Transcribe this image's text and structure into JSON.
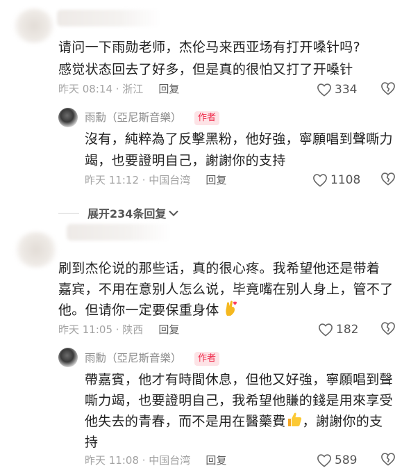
{
  "comment1": {
    "text_line1": "请问一下雨勋老师，杰伦马来西亚场有打开嗓针吗?",
    "text_line2": "感觉状态回去了好多，但是真的很怕又打了开嗓针",
    "meta": "昨天 08:14 · 浙江",
    "reply_label": "回复",
    "likes": "334"
  },
  "reply1": {
    "author": "雨勳（亞尼斯音樂）",
    "badge": "作者",
    "text_line1": "沒有，純粹為了反擊黑粉，他好強，寧願唱到聲嘶力",
    "text_line2": "竭，也要證明自己，謝謝你的支持",
    "meta": "昨天 11:12 · 中国台湾",
    "reply_label": "回复",
    "likes": "1108"
  },
  "expand": {
    "label": "展开234条回复"
  },
  "comment2": {
    "text_line1": "刷到杰伦说的那些话，真的很心疼。我希望他还是带着",
    "text_line2": "嘉宾，不用在意别人怎么说，毕竟嘴在别人身上，管不了",
    "text_line3": "他。但请你一定要保重身体",
    "meta": "昨天 11:05 · 陕西",
    "reply_label": "回复",
    "likes": "182"
  },
  "reply2": {
    "author": "雨勳（亞尼斯音樂）",
    "badge": "作者",
    "text_line1": "帶嘉賓，他才有時間休息，但他又好強，寧願唱到聲",
    "text_line2": "嘶力竭，也要證明自己，我希望他賺的錢是用來享受",
    "text_line3a": "他失去的青春，而不是用在醫藥費",
    "text_line3b": "，謝謝你的支",
    "text_line4": "持",
    "meta": "昨天 11:08 · 中国台湾",
    "reply_label": "回复",
    "likes": "589"
  },
  "icons": {
    "like": "heart-outline-icon",
    "dislike": "broken-heart-icon",
    "expand": "chevron-down-icon",
    "emoji1": "crossed-fingers-heart-emoji",
    "emoji2": "thumbs-up-emoji"
  }
}
